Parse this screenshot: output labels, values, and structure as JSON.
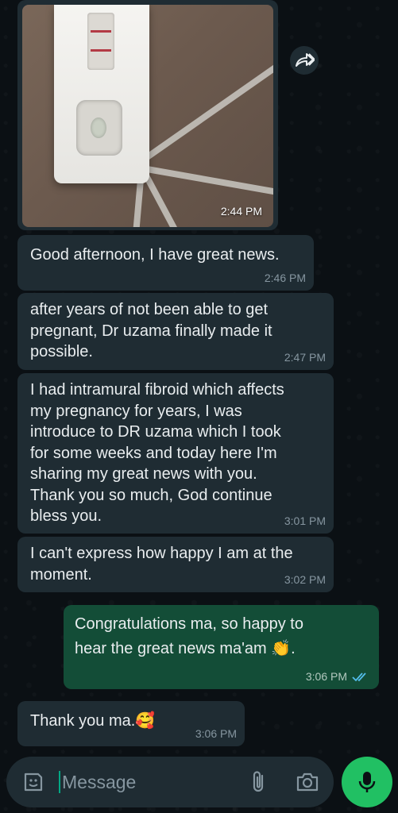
{
  "chat": {
    "image_message": {
      "time": "2:44 PM"
    },
    "messages": [
      {
        "direction": "in",
        "text": "Good afternoon, I have great news.",
        "time": "2:46 PM"
      },
      {
        "direction": "in",
        "text": "after years of not been able to get\npregnant, Dr uzama finally made it\npossible.",
        "time": "2:47 PM"
      },
      {
        "direction": "in",
        "text": "I had intramural fibroid which affects\nmy pregnancy for years, I was\nintroduce to DR uzama which I took\nfor some weeks and today here I'm\nsharing my great news with you.\nThank you so much, God continue\nbless you.",
        "time": "3:01 PM"
      },
      {
        "direction": "in",
        "text": "I can't express how happy I am at the\nmoment.",
        "time": "3:02 PM"
      },
      {
        "direction": "out",
        "text": "Congratulations ma, so happy to\nhear the great news ma'am 👏.",
        "time": "3:06 PM",
        "status": "read"
      },
      {
        "direction": "in",
        "text": "Thank you ma.🥰",
        "time": "3:06 PM"
      }
    ]
  },
  "composer": {
    "placeholder": "Message"
  },
  "icons": {
    "forward": "forward-icon",
    "emoji": "sticker-icon",
    "attach": "paperclip-icon",
    "camera": "camera-icon",
    "mic": "mic-icon",
    "read_receipt": "double-check-icon"
  },
  "colors": {
    "incoming_bubble": "#1f2c33",
    "outgoing_bubble": "#134d37",
    "accent": "#21c063",
    "read_tick": "#53bdeb"
  }
}
